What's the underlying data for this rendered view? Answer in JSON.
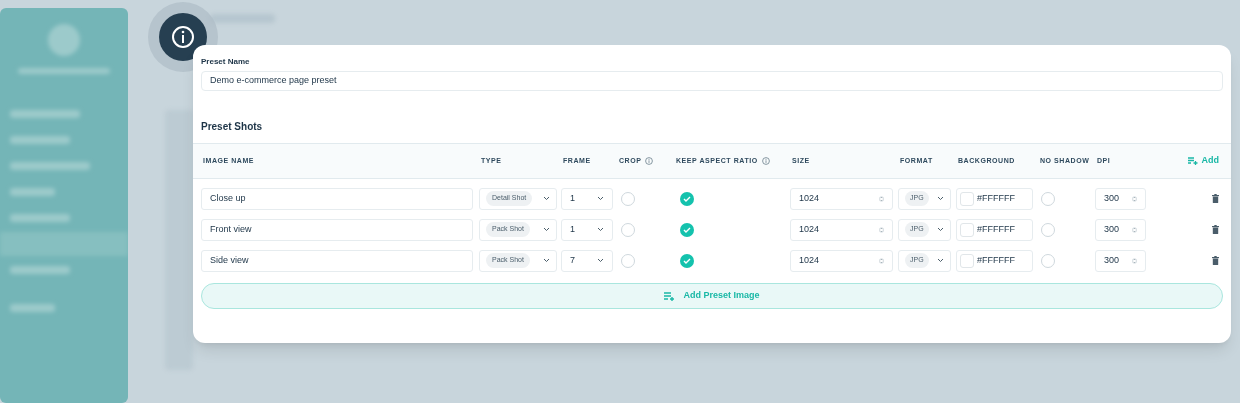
{
  "dialog": {
    "preset_name_label": "Preset Name",
    "preset_name": "Demo e-commerce page preset",
    "section_title": "Preset Shots"
  },
  "columns": [
    {
      "label": "IMAGE NAME",
      "info": false
    },
    {
      "label": "TYPE",
      "info": false
    },
    {
      "label": "FRAME",
      "info": false
    },
    {
      "label": "CROP",
      "info": true
    },
    {
      "label": "KEEP ASPECT RATIO",
      "info": true
    },
    {
      "label": "SIZE",
      "info": false
    },
    {
      "label": "FORMAT",
      "info": false
    },
    {
      "label": "BACKGROUND",
      "info": false
    },
    {
      "label": "NO SHADOW",
      "info": false
    },
    {
      "label": "DPI",
      "info": false
    }
  ],
  "add_label": "Add",
  "rows": [
    {
      "name": "Close up",
      "type": "Detail Shot",
      "frame": "1",
      "crop": false,
      "keep_aspect_ratio": true,
      "size": "1024",
      "format": "JPG",
      "background": "#FFFFFF",
      "no_shadow": false,
      "dpi": "300"
    },
    {
      "name": "Front view",
      "type": "Pack Shot",
      "frame": "1",
      "crop": false,
      "keep_aspect_ratio": true,
      "size": "1024",
      "format": "JPG",
      "background": "#FFFFFF",
      "no_shadow": false,
      "dpi": "300"
    },
    {
      "name": "Side view",
      "type": "Pack Shot",
      "frame": "7",
      "crop": false,
      "keep_aspect_ratio": true,
      "size": "1024",
      "format": "JPG",
      "background": "#FFFFFF",
      "no_shadow": false,
      "dpi": "300"
    }
  ],
  "add_preset_image": "Add Preset Image"
}
